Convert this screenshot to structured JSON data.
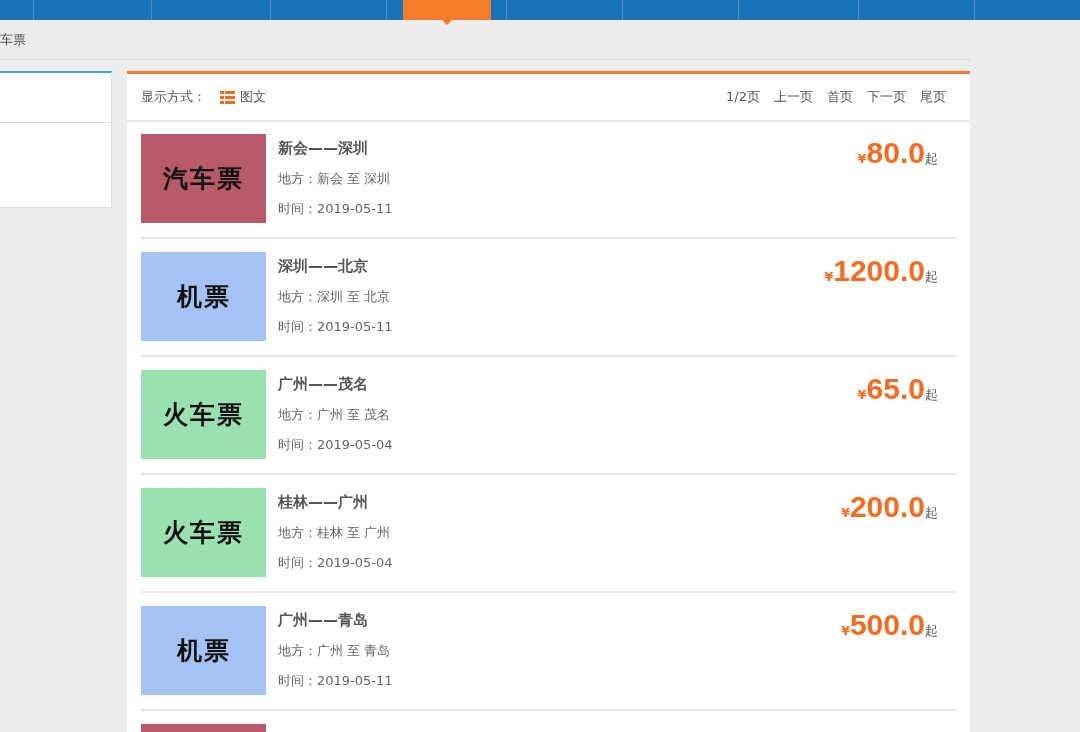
{
  "nav": {
    "tabs": [
      {
        "selected": false
      },
      {
        "selected": false
      },
      {
        "selected": false
      },
      {
        "selected": true
      },
      {
        "selected": false
      },
      {
        "selected": false
      },
      {
        "selected": false
      },
      {
        "selected": false
      }
    ]
  },
  "breadcrumb": "车票",
  "toolbar": {
    "display_label": "显示方式：",
    "view_mode": "图文",
    "pager": [
      "1/2页",
      "上一页",
      "首页",
      "下一页",
      "尾页"
    ]
  },
  "tickets": [
    {
      "image_label": "汽车票",
      "color": "#b85a68",
      "title": "新会——深圳",
      "place": "地方：新会 至 深圳",
      "time": "时间：2019-05-11",
      "currency": "¥",
      "price": "80.0",
      "suffix": "起"
    },
    {
      "image_label": "机票",
      "color": "#a4c2f4",
      "title": "深圳——北京",
      "place": "地方：深圳 至 北京",
      "time": "时间：2019-05-11",
      "currency": "¥",
      "price": "1200.0",
      "suffix": "起"
    },
    {
      "image_label": "火车票",
      "color": "#9be0b1",
      "title": "广州——茂名",
      "place": "地方：广州 至 茂名",
      "time": "时间：2019-05-04",
      "currency": "¥",
      "price": "65.0",
      "suffix": "起"
    },
    {
      "image_label": "火车票",
      "color": "#9be0b1",
      "title": "桂林——广州",
      "place": "地方：桂林 至 广州",
      "time": "时间：2019-05-04",
      "currency": "¥",
      "price": "200.0",
      "suffix": "起"
    },
    {
      "image_label": "机票",
      "color": "#a4c2f4",
      "title": "广州——青岛",
      "place": "地方：广州 至 青岛",
      "time": "时间：2019-05-11",
      "currency": "¥",
      "price": "500.0",
      "suffix": "起"
    },
    {
      "color": "#b85a68"
    }
  ]
}
